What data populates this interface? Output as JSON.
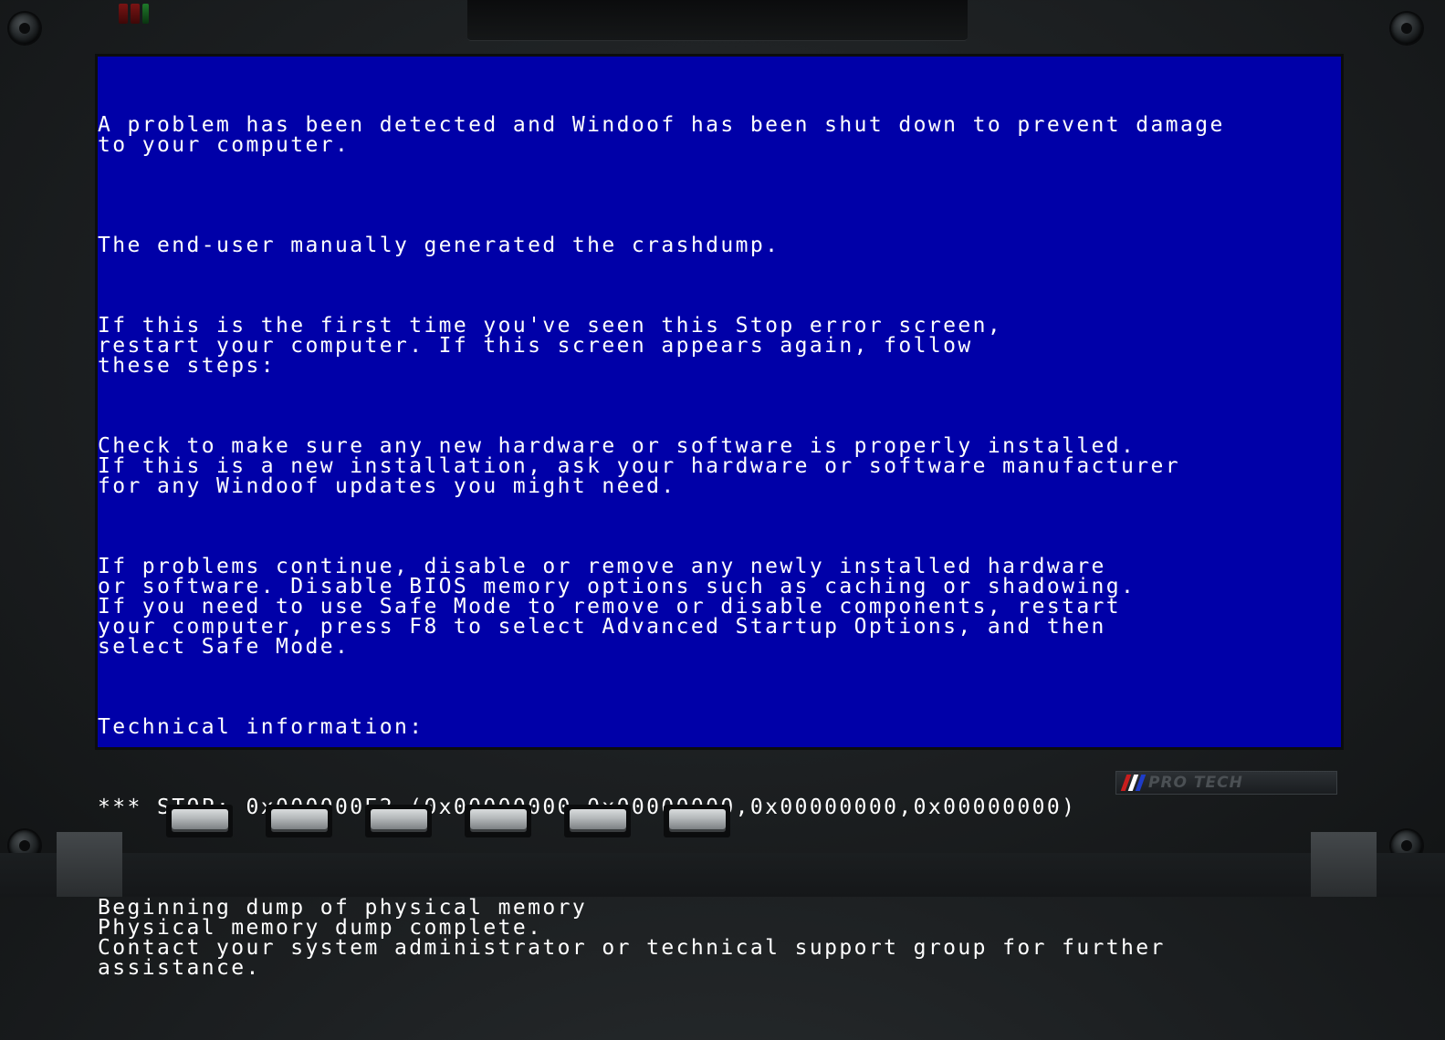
{
  "bsod": {
    "paragraphs": [
      "A problem has been detected and Windoof has been shut down to prevent damage\nto your computer.",
      "The end-user manually generated the crashdump.",
      "If this is the first time you've seen this Stop error screen,\nrestart your computer. If this screen appears again, follow\nthese steps:",
      "Check to make sure any new hardware or software is properly installed.\nIf this is a new installation, ask your hardware or software manufacturer\nfor any Windoof updates you might need.",
      "If problems continue, disable or remove any newly installed hardware\nor software. Disable BIOS memory options such as caching or shadowing.\nIf you need to use Safe Mode to remove or disable components, restart\nyour computer, press F8 to select Advanced Startup Options, and then\nselect Safe Mode.",
      "Technical information:",
      "*** STOP: 0x000000E2 (0x00000000,0x00000000,0x00000000,0x00000000)",
      "Beginning dump of physical memory\nPhysical memory dump complete.\nContact your system administrator or technical support group for further\nassistance."
    ]
  },
  "colors": {
    "screen_background": "#0000a8",
    "screen_text": "#ffffff",
    "bezel": "#1e2123"
  },
  "badge": {
    "text": "PRO TECH",
    "stripe_colors": [
      "#c81e1e",
      "#ffffff",
      "#1e3cc8"
    ]
  },
  "hardware_buttons": {
    "count": 6
  }
}
